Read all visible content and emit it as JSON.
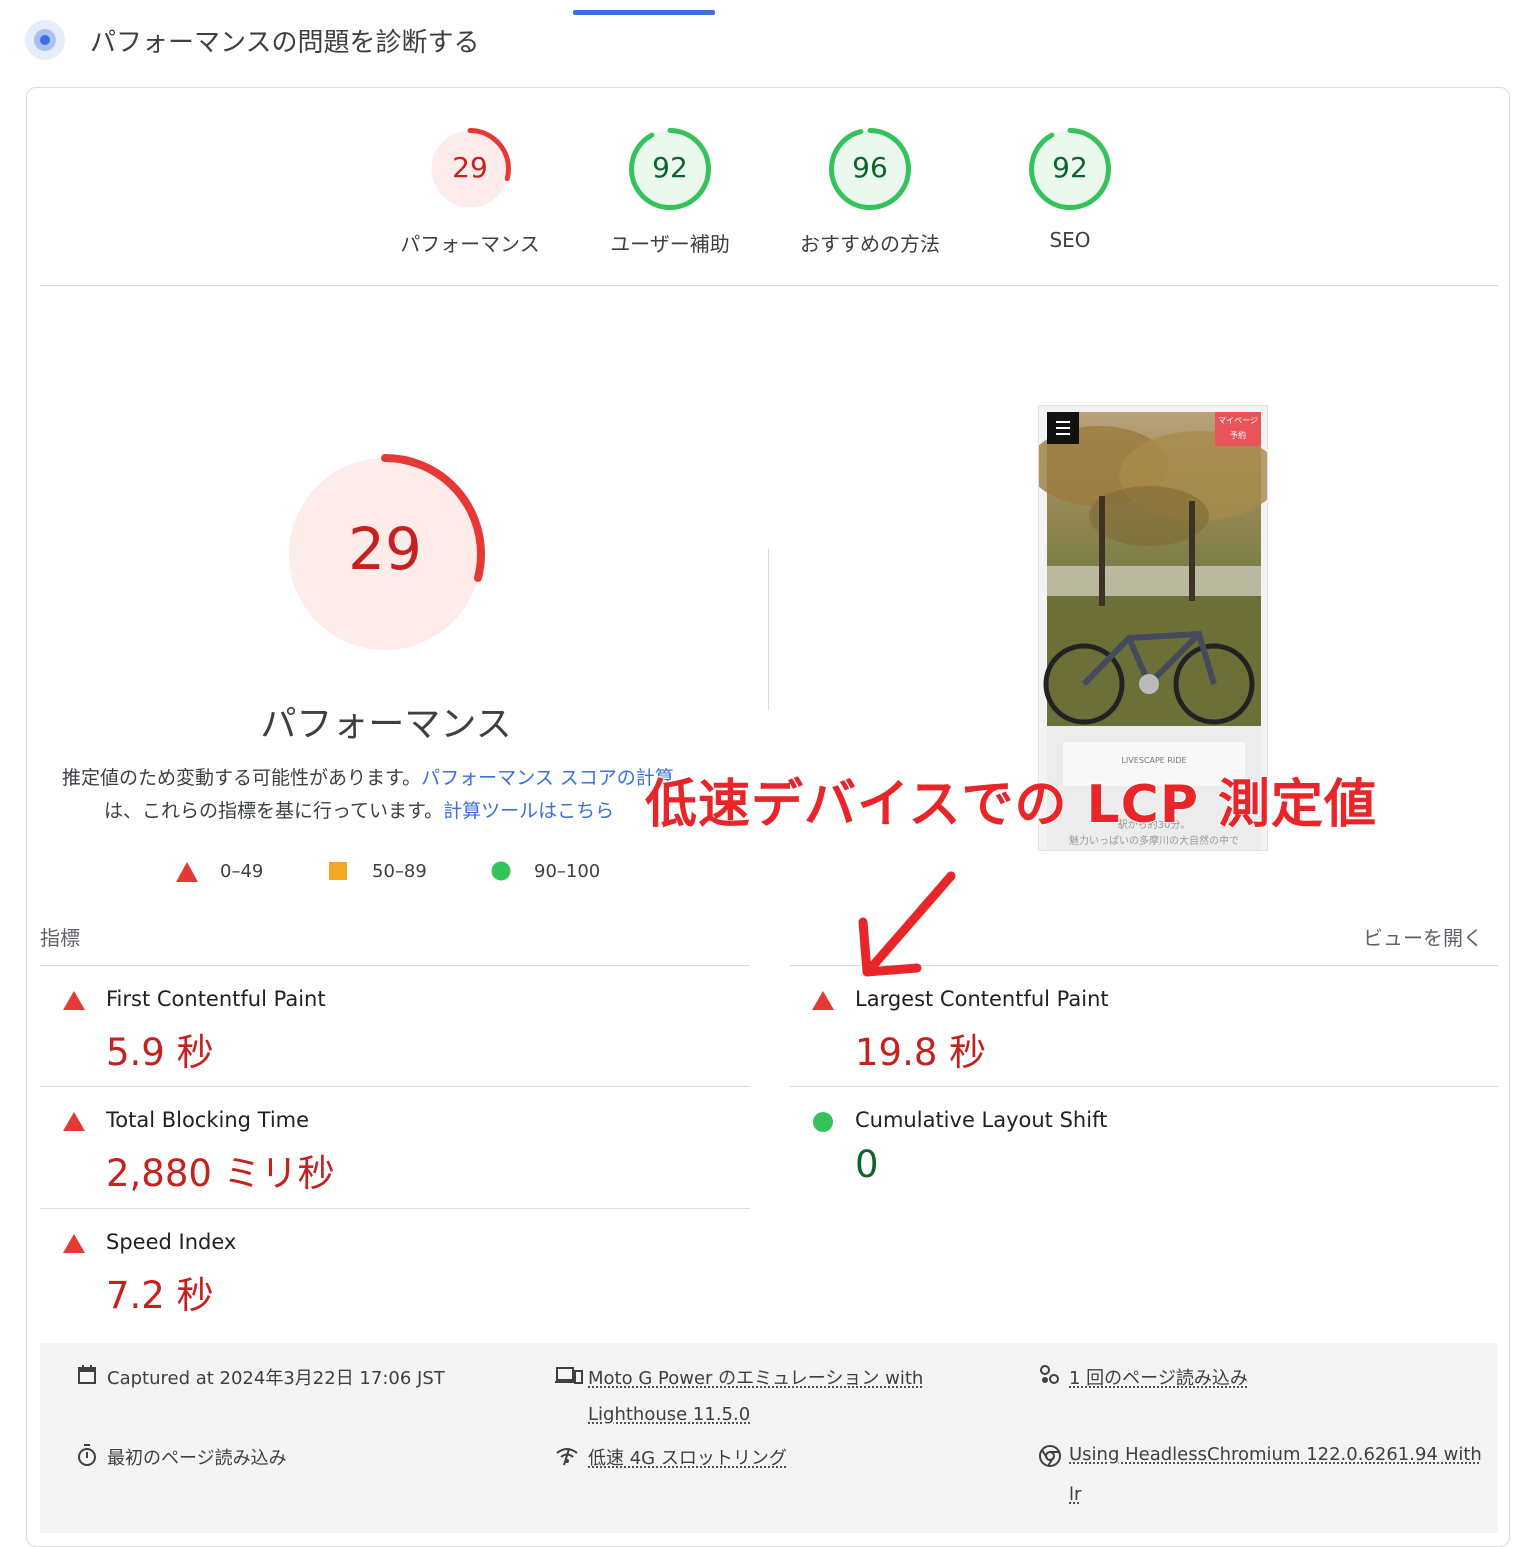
{
  "header": {
    "title": "パフォーマンスの問題を診断する"
  },
  "categories": [
    {
      "score": "29",
      "label": "パフォーマンス",
      "fraction": 0.29,
      "status": "fail"
    },
    {
      "score": "92",
      "label": "ユーザー補助",
      "fraction": 0.92,
      "status": "pass"
    },
    {
      "score": "96",
      "label": "おすすめの方法",
      "fraction": 0.96,
      "status": "pass"
    },
    {
      "score": "92",
      "label": "SEO",
      "fraction": 0.92,
      "status": "pass"
    }
  ],
  "main_gauge": {
    "score": "29",
    "fraction": 0.29,
    "title": "パフォーマンス"
  },
  "description": {
    "line1_text": "推定値のため変動する可能性があります。",
    "line1_link": "パフォーマンス スコアの計算",
    "line2_text": "は、これらの指標を基に行っています。",
    "line2_link": "計算ツールはこちら"
  },
  "legend": [
    {
      "range": "0–49",
      "shape": "triangle",
      "color": "#e53935"
    },
    {
      "range": "50–89",
      "shape": "square",
      "color": "#f5a623"
    },
    {
      "range": "90–100",
      "shape": "circle",
      "color": "#34c35b"
    }
  ],
  "metrics_header": {
    "title": "指標",
    "expand_label": "ビューを開く"
  },
  "metrics": [
    {
      "name": "First Contentful Paint",
      "value": "5.9 秒",
      "status": "fail"
    },
    {
      "name": "Largest Contentful Paint",
      "value": "19.8 秒",
      "status": "fail"
    },
    {
      "name": "Total Blocking Time",
      "value": "2,880 ミリ秒",
      "status": "fail"
    },
    {
      "name": "Cumulative Layout Shift",
      "value": "0",
      "status": "pass"
    },
    {
      "name": "Speed Index",
      "value": "7.2 秒",
      "status": "fail"
    }
  ],
  "footer": {
    "captured": "Captured at 2024年3月22日 17:06 JST",
    "device_line1": "Moto G Power のエミュレーション with",
    "device_line2": "Lighthouse 11.5.0",
    "page_loads": "1 回のページ読み込み",
    "initial_load": "最初のページ読み込み",
    "throttling": "低速 4G スロットリング",
    "browser_line1": "Using HeadlessChromium 122.0.6261.94 with",
    "browser_line2": "lr"
  },
  "thumbnail": {
    "mypage": "マイページ",
    "reserve": "予約",
    "text1": "LIVESCAPE RIDE",
    "text2": "駅から約30分。",
    "text3": "魅力いっぱいの多摩川の大自然の中で"
  },
  "annotation": {
    "text": "低速デバイスでの LCP 測定値"
  },
  "colors": {
    "fail": "#e53935",
    "fail_bg": "#fdecea",
    "pass": "#34c35b",
    "pass_bg": "#eaf8ee",
    "link": "#3c6ee0"
  }
}
